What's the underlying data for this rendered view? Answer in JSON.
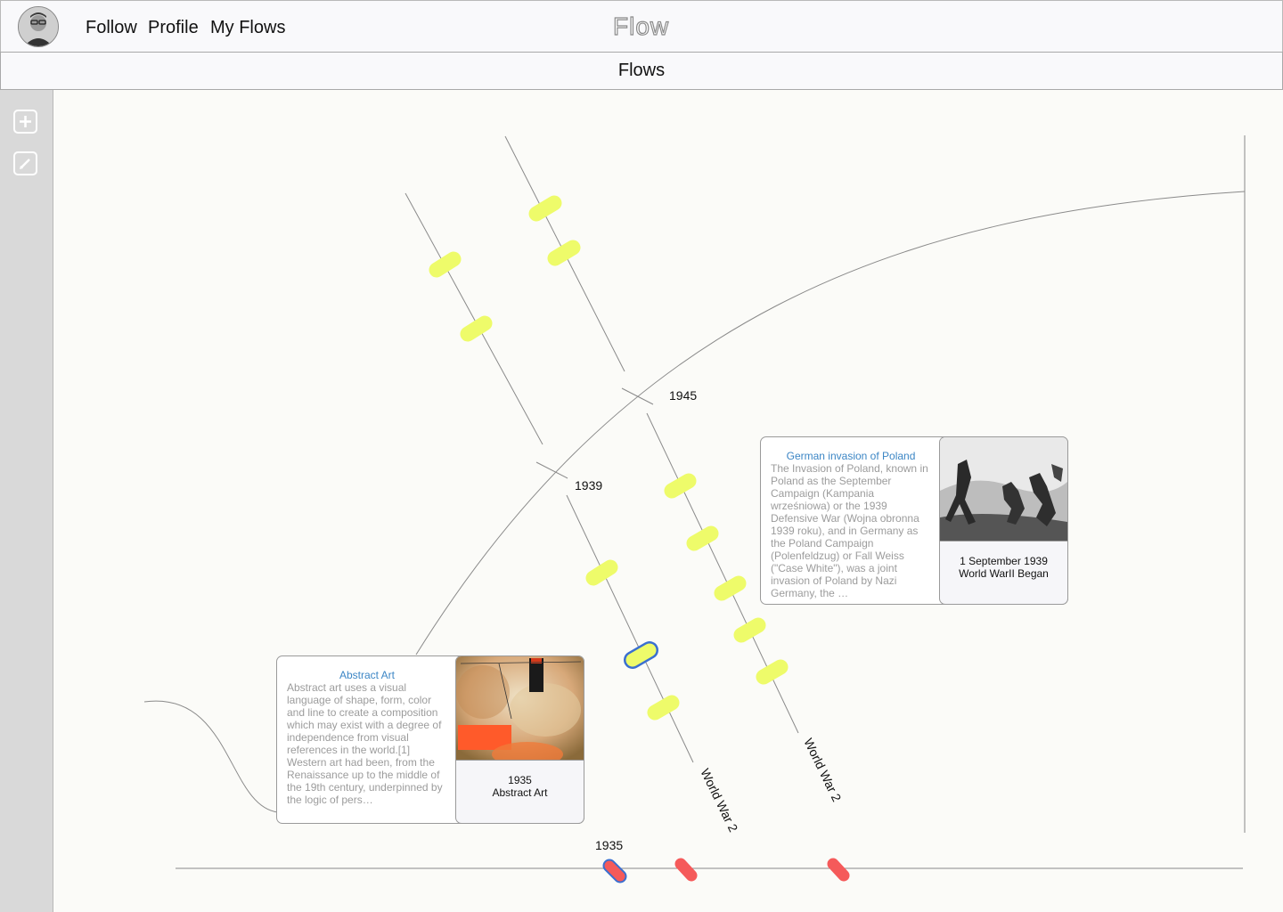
{
  "header": {
    "nav": [
      "Follow",
      "Profile",
      "My Flows"
    ],
    "brand": "Flow"
  },
  "subheader": {
    "title": "Flows"
  },
  "sidebar": {
    "tools": [
      "plus-icon",
      "edit-icon"
    ]
  },
  "timeline": {
    "markers": [
      {
        "label": "1945"
      },
      {
        "label": "1939"
      },
      {
        "label": "1935"
      }
    ],
    "flow_labels": [
      "World War 2",
      "World War 2"
    ]
  },
  "cards": {
    "poland": {
      "title": "German invasion of Poland",
      "body": "The Invasion of Poland, known in Poland as the September Campaign (Kampania wrześniowa) or the 1939 Defensive War (Wojna obronna 1939 roku), and in Germany as the Poland Campaign (Polenfeldzug) or Fall Weiss (\"Case White\"), was a joint invasion of Poland by Nazi Germany, the …",
      "date": "1 September 1939",
      "name": "World WarII Began"
    },
    "abstract": {
      "title": "Abstract Art",
      "body": "Abstract art uses a visual language of shape, form, color and line to create a composition which may exist with a degree of independence from visual references in the world.[1] Western art had been, from the Renaissance up to the middle of the 19th century, underpinned by the logic of pers…",
      "date": "1935",
      "name": "Abstract Art"
    }
  },
  "colors": {
    "event_pill": "#eefb6a",
    "selected_outline": "#3a6fd0",
    "bottom_pill": "#f55a5a",
    "line": "#8a8a8a"
  }
}
